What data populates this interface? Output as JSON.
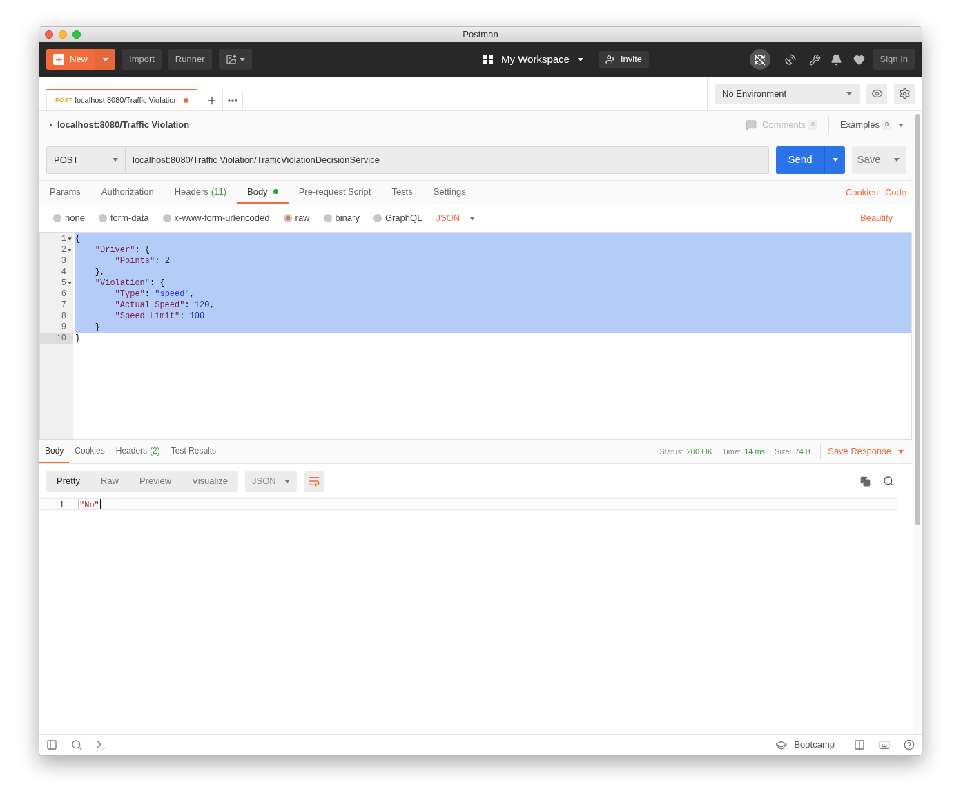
{
  "window": {
    "title": "Postman"
  },
  "header": {
    "new_button": "New",
    "buttons": [
      "Import",
      "Runner"
    ],
    "workspace": "My Workspace",
    "invite": "Invite",
    "sign_in": "Sign In"
  },
  "open_tabs": [
    {
      "method": "POST",
      "title": "localhost:8080/Traffic Violation",
      "unsaved": true,
      "selected": true
    }
  ],
  "environment": "No Environment",
  "breadcrumb": "localhost:8080/Traffic Violation",
  "comments": {
    "label": "Comments",
    "count": "0"
  },
  "examples": {
    "label": "Examples",
    "count": "0"
  },
  "request": {
    "method": "POST",
    "url": "localhost:8080/Traffic Violation/TrafficViolationDecisionService",
    "send": "Send",
    "save": "Save"
  },
  "request_sections": [
    {
      "label": "Params",
      "selected": false
    },
    {
      "label": "Authorization",
      "selected": false
    },
    {
      "label": "Headers",
      "count": "(11)",
      "selected": false
    },
    {
      "label": "Body",
      "selected": true,
      "dot": true
    },
    {
      "label": "Pre-request Script",
      "selected": false
    },
    {
      "label": "Tests",
      "selected": false
    },
    {
      "label": "Settings",
      "selected": false
    }
  ],
  "links": [
    "Cookies",
    "Code"
  ],
  "body_types": [
    {
      "label": "none",
      "selected": false
    },
    {
      "label": "form-data",
      "selected": false
    },
    {
      "label": "x-www-form-urlencoded",
      "selected": false
    },
    {
      "label": "raw",
      "selected": true
    },
    {
      "label": "binary",
      "selected": false
    },
    {
      "label": "GraphQL",
      "selected": false
    }
  ],
  "body_format": "JSON",
  "beautify": "Beautify",
  "code_lines": [
    {
      "number": "1",
      "foldable": true,
      "selected": true,
      "active": false,
      "tokens": [
        {
          "text": "{",
          "kind": "punct"
        }
      ]
    },
    {
      "number": "2",
      "foldable": true,
      "selected": true,
      "active": false,
      "tokens": [
        {
          "text": "    \"Driver\"",
          "kind": "key"
        },
        {
          "text": ": {",
          "kind": "punct"
        }
      ]
    },
    {
      "number": "3",
      "foldable": false,
      "selected": true,
      "active": false,
      "tokens": [
        {
          "text": "        \"Points\"",
          "kind": "key"
        },
        {
          "text": ": ",
          "kind": "punct"
        },
        {
          "text": "2",
          "kind": "number"
        }
      ]
    },
    {
      "number": "4",
      "foldable": false,
      "selected": true,
      "active": false,
      "tokens": [
        {
          "text": "    },",
          "kind": "punct"
        }
      ]
    },
    {
      "number": "5",
      "foldable": true,
      "selected": true,
      "active": false,
      "tokens": [
        {
          "text": "    \"Violation\"",
          "kind": "key"
        },
        {
          "text": ": {",
          "kind": "punct"
        }
      ]
    },
    {
      "number": "6",
      "foldable": false,
      "selected": true,
      "active": false,
      "tokens": [
        {
          "text": "        \"Type\"",
          "kind": "key"
        },
        {
          "text": ": ",
          "kind": "punct"
        },
        {
          "text": "\"speed\"",
          "kind": "string"
        },
        {
          "text": ",",
          "kind": "punct"
        }
      ]
    },
    {
      "number": "7",
      "foldable": false,
      "selected": true,
      "active": false,
      "tokens": [
        {
          "text": "        \"Actual Speed\"",
          "kind": "key"
        },
        {
          "text": ": ",
          "kind": "punct"
        },
        {
          "text": "120",
          "kind": "number"
        },
        {
          "text": ",",
          "kind": "punct"
        }
      ]
    },
    {
      "number": "8",
      "foldable": false,
      "selected": true,
      "active": false,
      "tokens": [
        {
          "text": "        \"Speed Limit\"",
          "kind": "key"
        },
        {
          "text": ": ",
          "kind": "punct"
        },
        {
          "text": "100",
          "kind": "number"
        }
      ]
    },
    {
      "number": "9",
      "foldable": false,
      "selected": true,
      "active": false,
      "tokens": [
        {
          "text": "    }",
          "kind": "punct"
        }
      ]
    },
    {
      "number": "10",
      "foldable": false,
      "selected": false,
      "active": true,
      "tokens": [
        {
          "text": "}",
          "kind": "punct"
        }
      ]
    }
  ],
  "response_sections": [
    {
      "label": "Body",
      "selected": true
    },
    {
      "label": "Cookies",
      "selected": false
    },
    {
      "label": "Headers",
      "count": "(2)",
      "selected": false
    },
    {
      "label": "Test Results",
      "selected": false
    }
  ],
  "status": [
    {
      "label": "Status:",
      "value": "200 OK"
    },
    {
      "label": "Time:",
      "value": "14 ms"
    },
    {
      "label": "Size:",
      "value": "74 B"
    }
  ],
  "save_response": "Save Response",
  "view_modes": [
    {
      "label": "Pretty",
      "selected": true
    },
    {
      "label": "Raw",
      "selected": false
    },
    {
      "label": "Preview",
      "selected": false
    },
    {
      "label": "Visualize",
      "selected": false
    }
  ],
  "response_format": "JSON",
  "response_lines": [
    {
      "number": "1",
      "text": "\"No\""
    }
  ],
  "footer": {
    "bootcamp": "Bootcamp"
  }
}
